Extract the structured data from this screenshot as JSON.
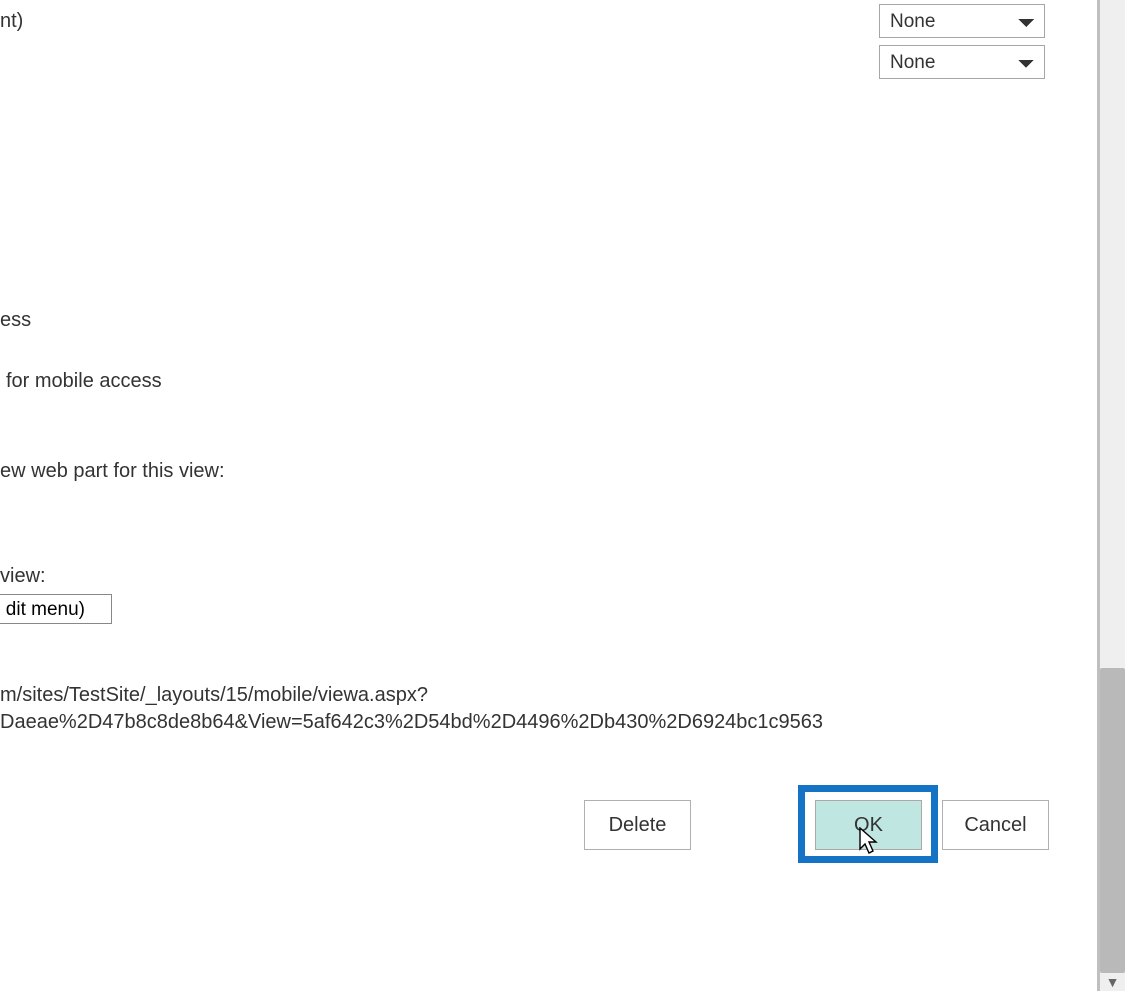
{
  "selects": {
    "top1": {
      "value": "None"
    },
    "top2": {
      "value": "None"
    }
  },
  "fragments": {
    "nt": "nt)",
    "ess": "ess",
    "mobile_access": "for mobile access",
    "web_part": "ew web part for this view:",
    "view_colon": "view:",
    "dit_menu": "dit menu)",
    "url_line1": "m/sites/TestSite/_layouts/15/mobile/viewa.aspx?",
    "url_line2": "Daeae%2D47b8c8de8b64&View=5af642c3%2D54bd%2D4496%2Db430%2D6924bc1c9563"
  },
  "buttons": {
    "delete": "Delete",
    "ok": "OK",
    "cancel": "Cancel"
  }
}
